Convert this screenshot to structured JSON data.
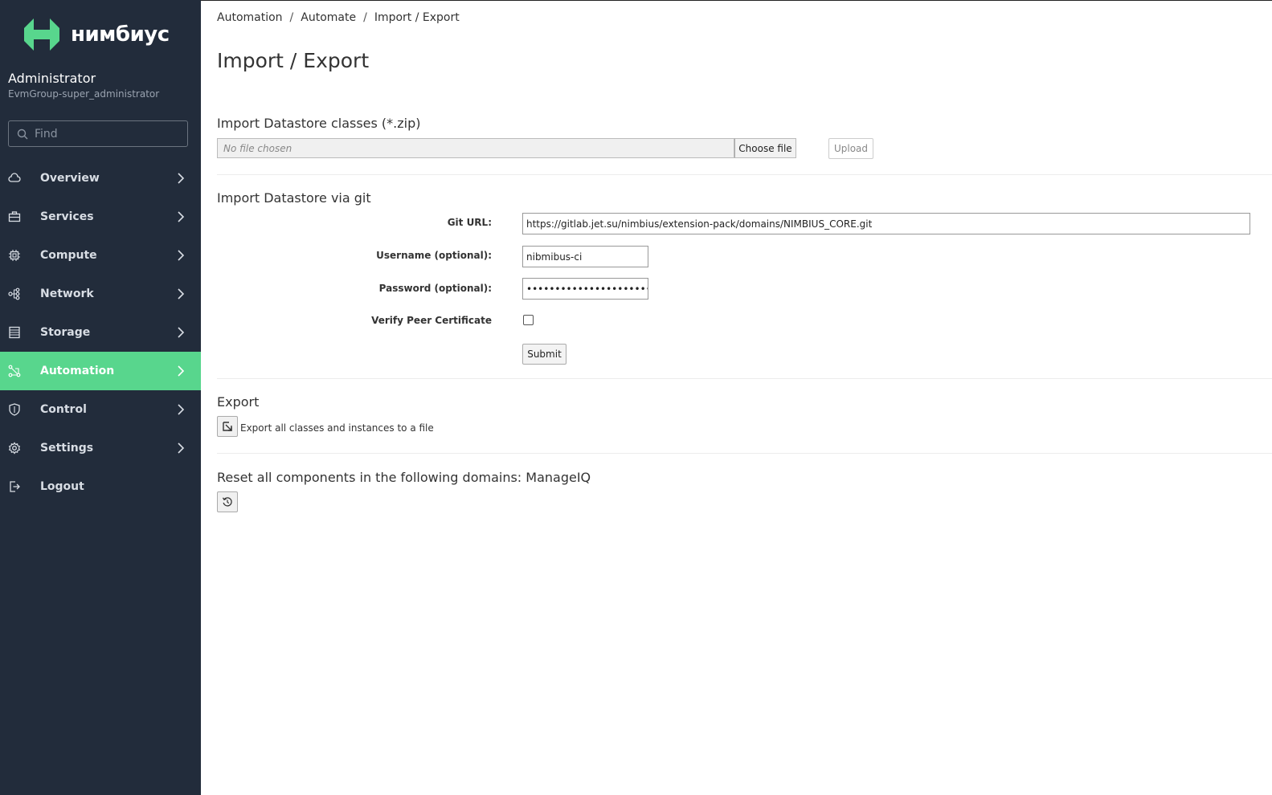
{
  "sidebar": {
    "logo_text": "нимбиус",
    "user_name": "Administrator",
    "user_group": "EvmGroup-super_administrator",
    "search_placeholder": "Find",
    "active_color": "#58d68d",
    "items": [
      {
        "label": "Overview",
        "icon": "cloud-icon"
      },
      {
        "label": "Services",
        "icon": "briefcase-icon"
      },
      {
        "label": "Compute",
        "icon": "chip-icon"
      },
      {
        "label": "Network",
        "icon": "network-icon"
      },
      {
        "label": "Storage",
        "icon": "storage-icon"
      },
      {
        "label": "Automation",
        "icon": "automation-icon",
        "active": true
      },
      {
        "label": "Control",
        "icon": "shield-icon"
      },
      {
        "label": "Settings",
        "icon": "gear-icon"
      },
      {
        "label": "Logout",
        "icon": "logout-icon"
      }
    ]
  },
  "breadcrumb": [
    "Automation",
    "Automate",
    "Import / Export"
  ],
  "page_title": "Import / Export",
  "import_zip": {
    "title": "Import Datastore classes (*.zip)",
    "file_placeholder": "No file chosen",
    "choose_label": "Choose file",
    "upload_label": "Upload"
  },
  "import_git": {
    "title": "Import Datastore via git",
    "git_url_label": "Git URL:",
    "git_url_value": "https://gitlab.jet.su/nimbius/extension-pack/domains/NIMBIUS_CORE.git",
    "username_label": "Username (optional):",
    "username_value": "nibmibus-ci",
    "password_label": "Password (optional):",
    "password_value": "xxxxxxxxxxxxxxxxxxxxxxxxx",
    "verify_label": "Verify Peer Certificate",
    "verify_checked": false,
    "submit_label": "Submit"
  },
  "export": {
    "title": "Export",
    "text": "Export all classes and instances to a file"
  },
  "reset": {
    "title": "Reset all components in the following domains: ManageIQ"
  }
}
